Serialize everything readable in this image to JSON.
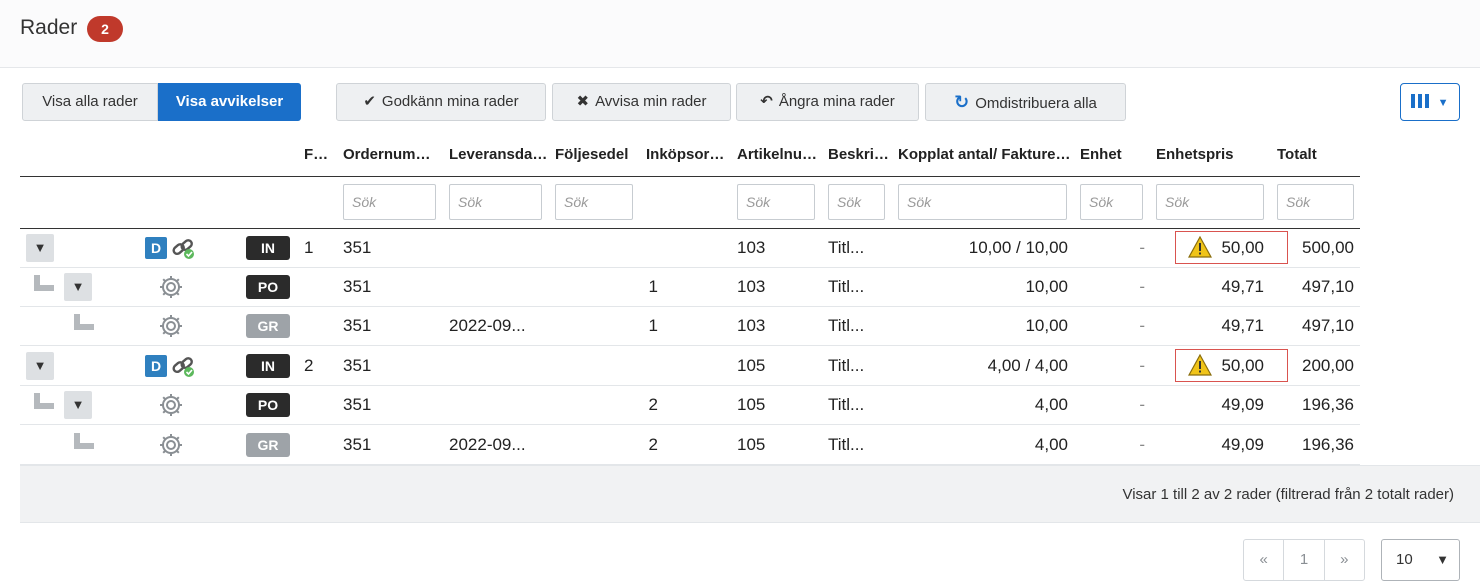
{
  "header": {
    "title": "Rader",
    "count": "2"
  },
  "toolbar": {
    "show_all": "Visa alla rader",
    "show_deviations": "Visa avvikelser",
    "approve": "Godkänn mina rader",
    "reject": "Avvisa min rader",
    "undo": "Ångra mina rader",
    "redistribute": "Omdistribuera alla"
  },
  "columns": {
    "fa": "Faktura rad",
    "order": "Ordernummer",
    "delivery": "Leveransdatum",
    "slip": "Följesedel",
    "purchase": "Inköpsordersrad",
    "article": "Artikelnummer",
    "desc": "Beskrivning",
    "qty": "Kopplat antal/ Fakturerat antal",
    "unit": "Enhet",
    "price": "Enhetspris",
    "total": "Totalt"
  },
  "search_placeholder": "Sök",
  "rows": [
    {
      "tag": "IN",
      "fa": "1",
      "order": "351",
      "delivery": "",
      "purchase": "",
      "article": "103",
      "desc": "Titl...",
      "qty": "10,00  / 10,00",
      "unit": "-",
      "price": "50,00",
      "total": "500,00"
    },
    {
      "tag": "PO",
      "fa": "",
      "order": "351",
      "delivery": "",
      "purchase": "1",
      "article": "103",
      "desc": "Titl...",
      "qty": "10,00",
      "unit": "-",
      "price": "49,71",
      "total": "497,10"
    },
    {
      "tag": "GR",
      "fa": "",
      "order": "351",
      "delivery": "2022-09...",
      "purchase": "1",
      "article": "103",
      "desc": "Titl...",
      "qty": "10,00",
      "unit": "-",
      "price": "49,71",
      "total": "497,10"
    },
    {
      "tag": "IN",
      "fa": "2",
      "order": "351",
      "delivery": "",
      "purchase": "",
      "article": "105",
      "desc": "Titl...",
      "qty": "4,00  / 4,00",
      "unit": "-",
      "price": "50,00",
      "total": "200,00"
    },
    {
      "tag": "PO",
      "fa": "",
      "order": "351",
      "delivery": "",
      "purchase": "2",
      "article": "105",
      "desc": "Titl...",
      "qty": "4,00",
      "unit": "-",
      "price": "49,09",
      "total": "196,36"
    },
    {
      "tag": "GR",
      "fa": "",
      "order": "351",
      "delivery": "2022-09...",
      "purchase": "2",
      "article": "105",
      "desc": "Titl...",
      "qty": "4,00",
      "unit": "-",
      "price": "49,09",
      "total": "196,36"
    }
  ],
  "footer": {
    "info": "Visar 1 till 2 av 2 rader (filtrerad från 2 totalt rader)",
    "pager_prev": "«",
    "pager_page": "1",
    "pager_next": "»",
    "page_size": "10"
  },
  "icons": {
    "chevron": "chevron-down-icon",
    "document": "d-document-icon",
    "link": "link-icon",
    "settings": "gear-icon",
    "warning": "warning-icon"
  },
  "colors": {
    "primary": "#1a6fc9",
    "badge": "#c0392b",
    "tag_dark": "#2b2b2b",
    "tag_grey": "#9ea3a8",
    "d_box": "#2f80bf",
    "warning": "#d9534f"
  }
}
